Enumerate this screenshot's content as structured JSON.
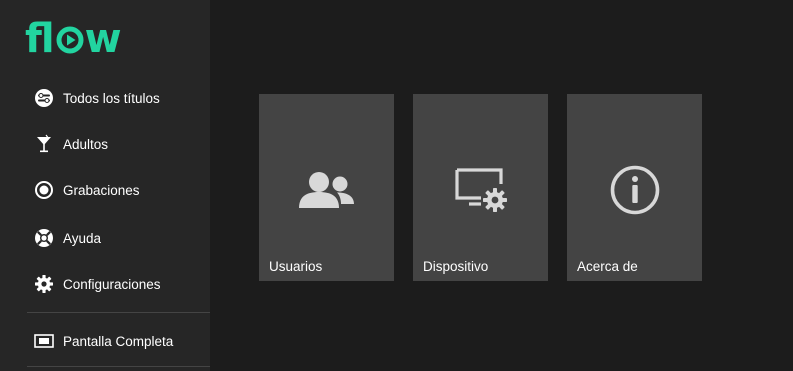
{
  "logo": {
    "text_left": "fl",
    "text_right": "w",
    "color": "#22d4a0"
  },
  "sidebar": {
    "items": [
      {
        "label": "Todos los títulos",
        "icon": "switch-icon"
      },
      {
        "label": "Adultos",
        "icon": "cocktail-icon"
      },
      {
        "label": "Grabaciones",
        "icon": "record-icon"
      },
      {
        "label": "Ayuda",
        "icon": "lifebuoy-icon"
      },
      {
        "label": "Configuraciones",
        "icon": "gear-icon"
      },
      {
        "label": "Pantalla Completa",
        "icon": "fullscreen-icon"
      }
    ]
  },
  "tiles": [
    {
      "label": "Usuarios",
      "icon": "users-icon"
    },
    {
      "label": "Dispositivo",
      "icon": "device-settings-icon"
    },
    {
      "label": "Acerca de",
      "icon": "info-icon"
    }
  ]
}
